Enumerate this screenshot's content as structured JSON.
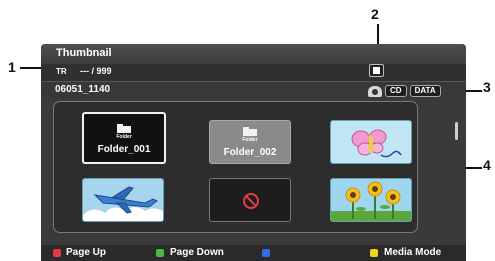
{
  "screen": {
    "title": "Thumbnail",
    "track_label": "TR",
    "track_value": "--- / 999",
    "folder_name": "06051_1140",
    "media_tags": [
      "CD",
      "DATA"
    ],
    "thumbnails": [
      {
        "type": "folder",
        "caption": "Folder",
        "label": "Folder_001",
        "selected": true
      },
      {
        "type": "folder",
        "caption": "Folder",
        "label": "Folder_002",
        "selected": false
      },
      {
        "type": "image",
        "subject": "butterfly"
      },
      {
        "type": "image",
        "subject": "airplane"
      },
      {
        "type": "invalid",
        "subject": "prohibited"
      },
      {
        "type": "image",
        "subject": "sunflowers"
      }
    ],
    "footer": {
      "page_up": "Page Up",
      "page_down": "Page Down",
      "blue": "",
      "media_mode": "Media Mode"
    },
    "button_colors": {
      "red": "#e23a3a",
      "green": "#3fbf4a",
      "blue": "#2f6fe0",
      "yellow": "#f1d21c"
    }
  },
  "callouts": [
    "1",
    "2",
    "3",
    "4"
  ]
}
